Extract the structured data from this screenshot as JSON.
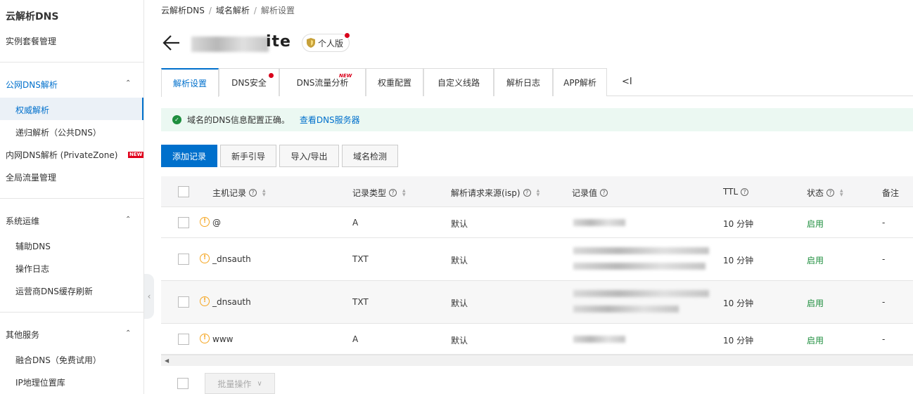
{
  "sidebar": {
    "title": "云解析DNS",
    "instance_mgmt": "实例套餐管理",
    "public_dns": "公网DNS解析",
    "authoritative": "权威解析",
    "recursive": "递归解析（公共DNS）",
    "private_zone": "内网DNS解析 (PrivateZone)",
    "new_tag": "NEW",
    "gtm": "全局流量管理",
    "ops": "系统运维",
    "aux_dns": "辅助DNS",
    "op_log": "操作日志",
    "isp_flush": "运营商DNS缓存刷新",
    "other": "其他服务",
    "fusion_dns": "融合DNS（免费试用）",
    "ip_geo": "IP地理位置库"
  },
  "breadcrumb": [
    "云解析DNS",
    "域名解析",
    "解析设置"
  ],
  "header": {
    "domain_suffix": "ite",
    "version": "个人版"
  },
  "tabs": [
    {
      "label": "解析设置"
    },
    {
      "label": "DNS安全"
    },
    {
      "label": "DNS流量分析",
      "badge": "NEW"
    },
    {
      "label": "权重配置"
    },
    {
      "label": "自定义线路"
    },
    {
      "label": "解析日志"
    },
    {
      "label": "APP解析"
    }
  ],
  "tab_more": "<I",
  "alert": {
    "text": "域名的DNS信息配置正确。",
    "link": "查看DNS服务器"
  },
  "toolbar": {
    "add": "添加记录",
    "guide": "新手引导",
    "import_export": "导入/导出",
    "check": "域名检测"
  },
  "columns": {
    "host": "主机记录",
    "type": "记录类型",
    "isp": "解析请求来源(isp)",
    "value": "记录值",
    "ttl": "TTL",
    "status": "状态",
    "remark": "备注"
  },
  "rows": [
    {
      "host": "@",
      "type": "A",
      "isp": "默认",
      "ttl": "10 分钟",
      "status": "启用",
      "remark": "-"
    },
    {
      "host": "_dnsauth",
      "type": "TXT",
      "isp": "默认",
      "ttl": "10 分钟",
      "status": "启用",
      "remark": "-"
    },
    {
      "host": "_dnsauth",
      "type": "TXT",
      "isp": "默认",
      "ttl": "10 分钟",
      "status": "启用",
      "remark": "-"
    },
    {
      "host": "www",
      "type": "A",
      "isp": "默认",
      "ttl": "10 分钟",
      "status": "启用",
      "remark": "-"
    }
  ],
  "footer": {
    "batch": "批量操作"
  },
  "colors": {
    "accent": "#0070cc",
    "success": "#1e8e3e",
    "warning": "#f5a623",
    "danger": "#d9001b"
  }
}
